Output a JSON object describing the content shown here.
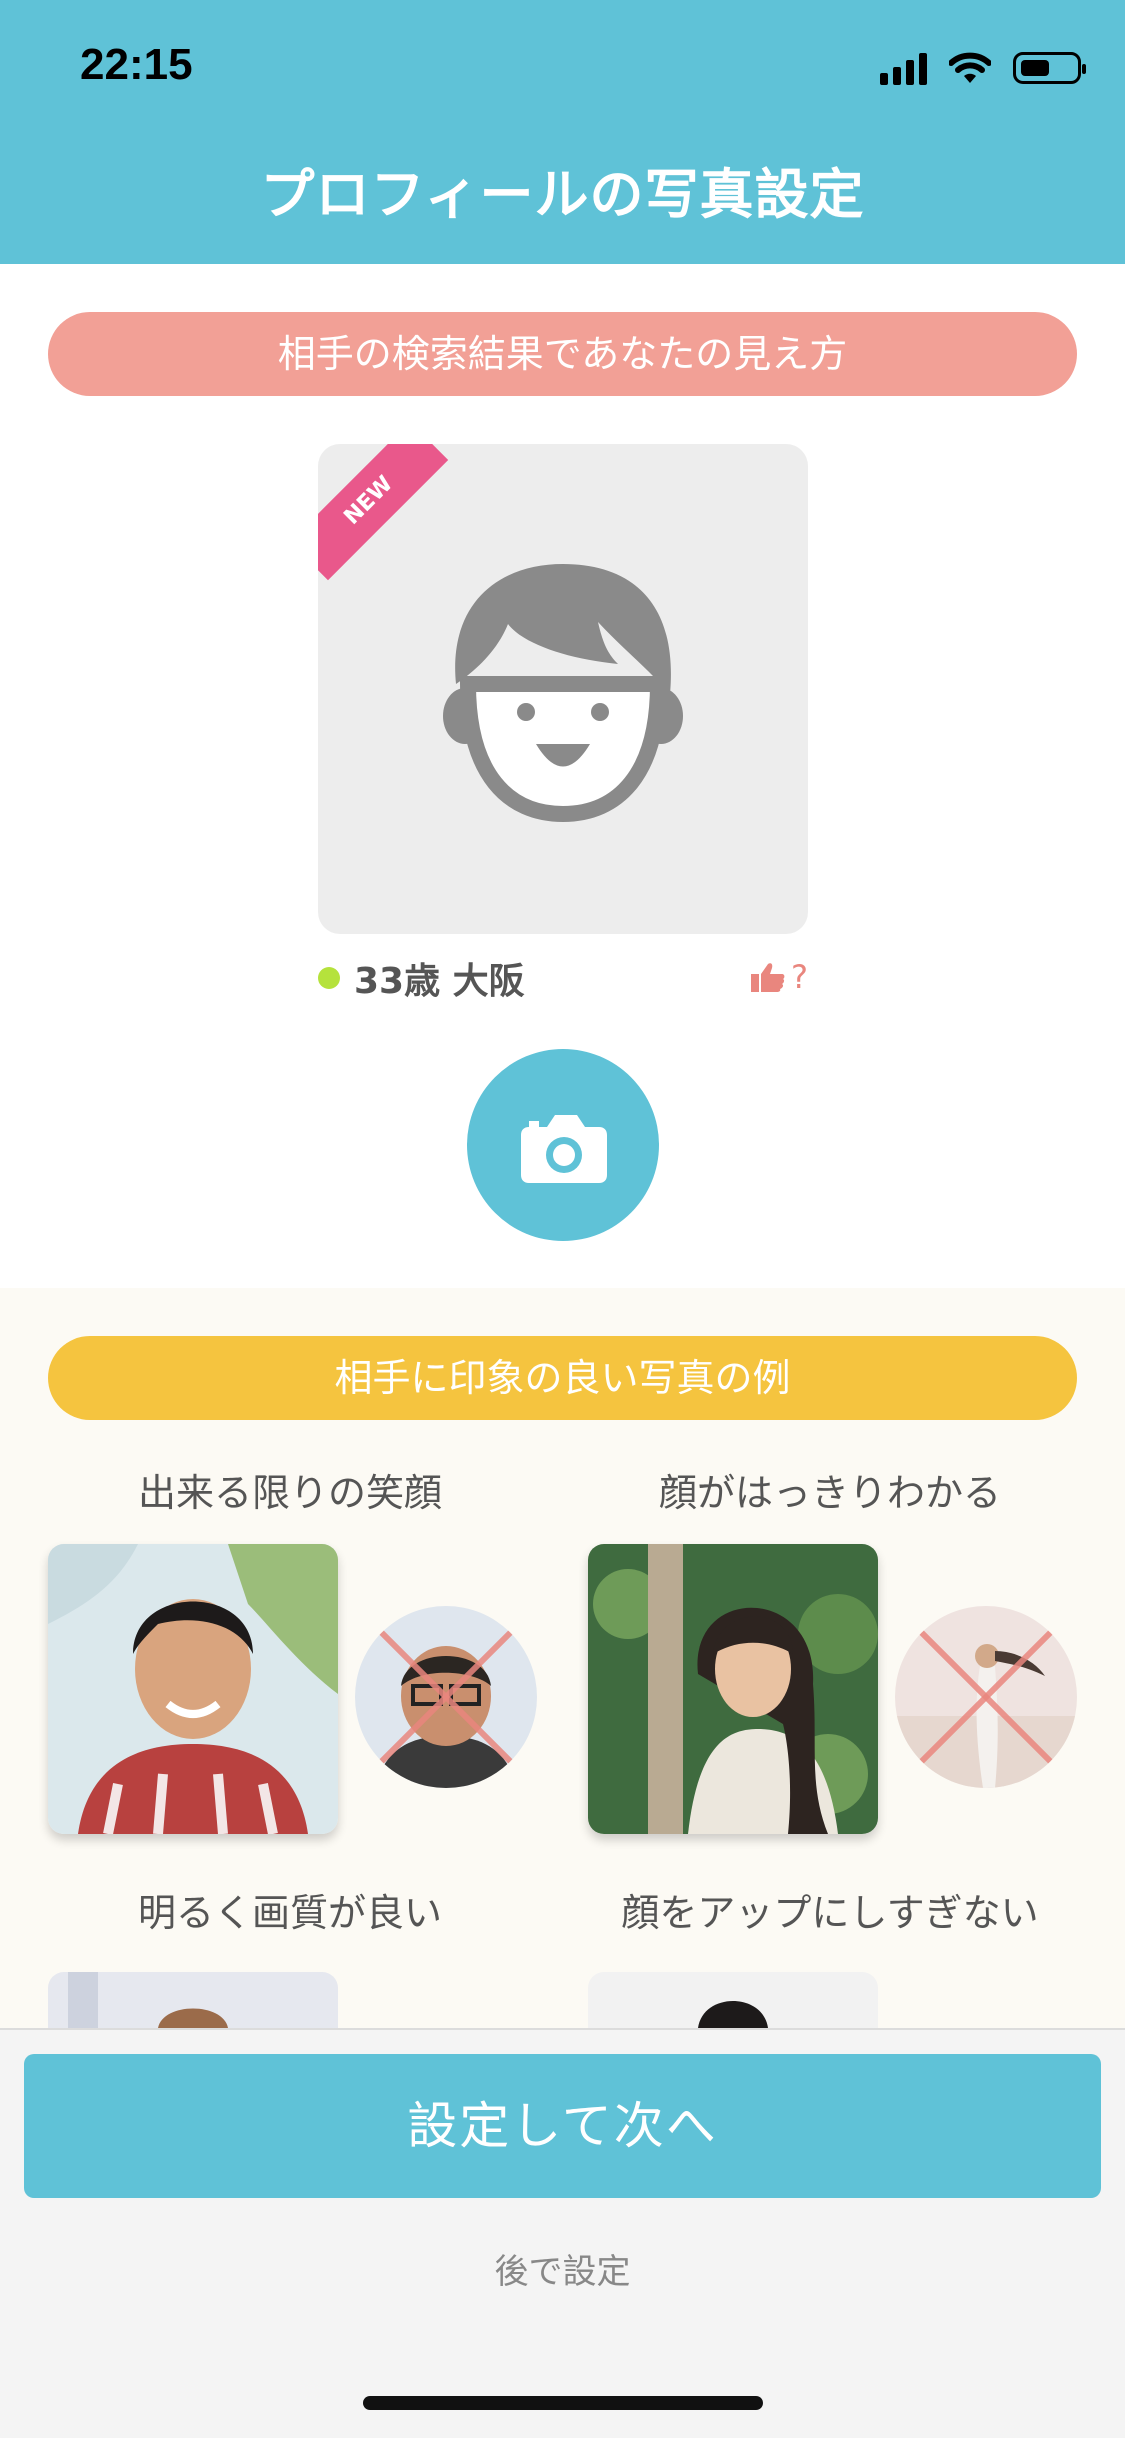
{
  "status_bar": {
    "time": "22:15"
  },
  "header": {
    "title": "プロフィールの写真設定"
  },
  "search_preview": {
    "banner": "相手の検索結果であなたの見え方",
    "badge": "NEW",
    "info": "33歳 大阪",
    "like_help": "?"
  },
  "examples": {
    "banner": "相手に印象の良い写真の例",
    "items": [
      {
        "caption": "出来る限りの笑顔"
      },
      {
        "caption": "顔がはっきりわかる"
      },
      {
        "caption": "明るく画質が良い"
      },
      {
        "caption": "顔をアップにしすぎない"
      }
    ]
  },
  "actions": {
    "primary": "設定して次へ",
    "later": "後で設定"
  },
  "colors": {
    "accent": "#5FC2D7",
    "pink": "#F2A096",
    "yellow": "#F5C43F",
    "new_badge": "#E9588B",
    "online": "#B5E23C"
  }
}
